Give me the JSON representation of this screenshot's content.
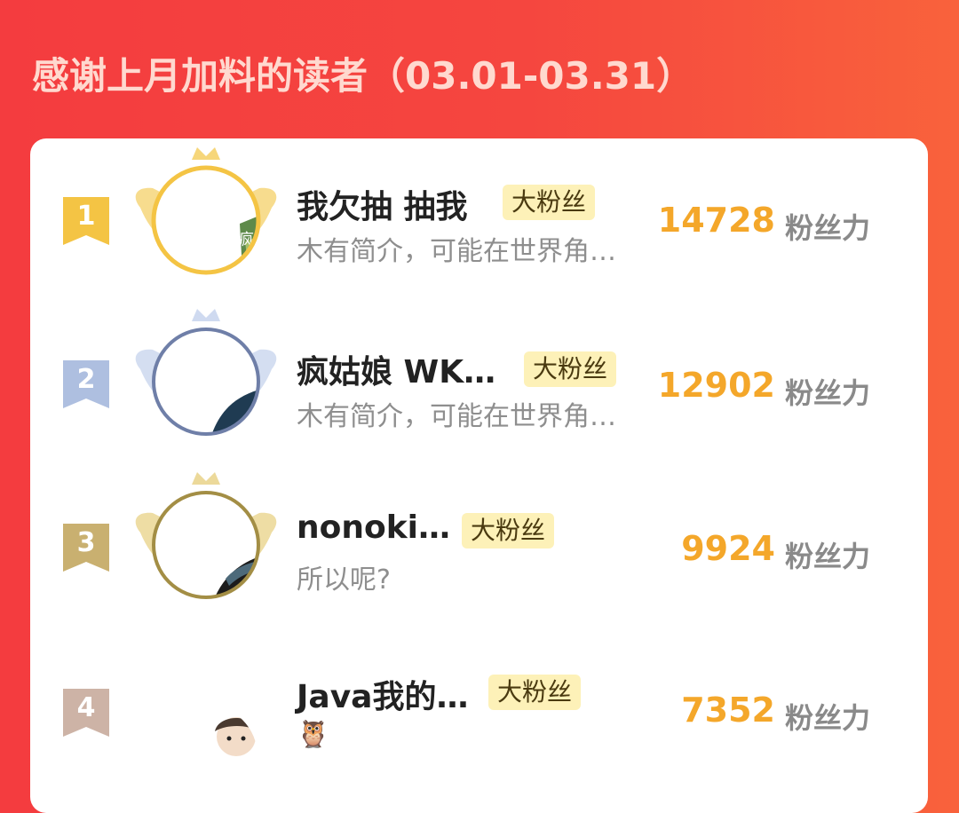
{
  "header": {
    "title": "感谢上月加料的读者（03.01-03.31）"
  },
  "colors": {
    "background_start": "#f43c3f",
    "background_end": "#f9623c",
    "title": "#ffd9cf",
    "score": "#f4a72a",
    "badge_bg": "#fdf1b8",
    "rank1": "#f4c444",
    "rank2": "#aebfe0",
    "rank3": "#c9b070",
    "rank4": "#cdb3a6"
  },
  "leaderboard": [
    {
      "rank": "1",
      "name": "我欠抽  抽我",
      "badge": "大粉丝",
      "bio": "木有简介，可能在世界角…",
      "score": "14728",
      "score_unit": "粉丝力",
      "avatar_frame": "gold-wings-crown",
      "avatar_text": "疯啦"
    },
    {
      "rank": "2",
      "name": "疯姑娘 WK…",
      "badge": "大粉丝",
      "bio": "木有简介，可能在世界角…",
      "score": "12902",
      "score_unit": "粉丝力",
      "avatar_frame": "silver-wings-crown"
    },
    {
      "rank": "3",
      "name": "nonoki…",
      "badge": "大粉丝",
      "bio": "所以呢?",
      "score": "9924",
      "score_unit": "粉丝力",
      "avatar_frame": "bronze-wings-crown"
    },
    {
      "rank": "4",
      "name": "Java我的…",
      "badge": "大粉丝",
      "bio": "🦉",
      "score": "7352",
      "score_unit": "粉丝力",
      "avatar_frame": "none"
    }
  ]
}
